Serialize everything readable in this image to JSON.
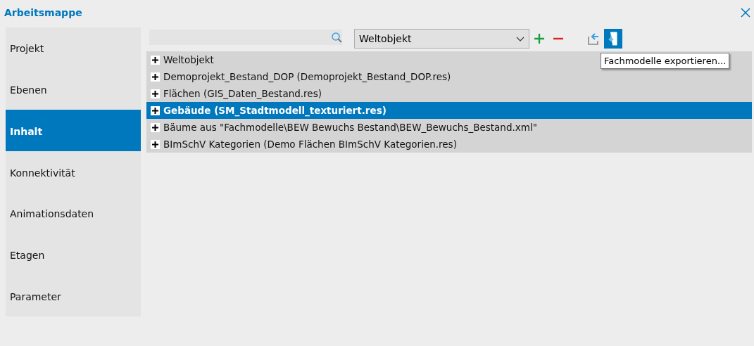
{
  "window": {
    "title": "Arbeitsmappe"
  },
  "sidebar": {
    "items": [
      {
        "label": "Projekt",
        "selected": false
      },
      {
        "label": "Ebenen",
        "selected": false
      },
      {
        "label": "Inhalt",
        "selected": true
      },
      {
        "label": "Konnektivität",
        "selected": false
      },
      {
        "label": "Animationsdaten",
        "selected": false
      },
      {
        "label": "Etagen",
        "selected": false
      },
      {
        "label": "Parameter",
        "selected": false
      }
    ]
  },
  "toolbar": {
    "dropdown": {
      "value": "Weltobjekt"
    },
    "buttons": [
      {
        "kind": "add",
        "highlighted": false
      },
      {
        "kind": "remove",
        "highlighted": false
      },
      {
        "kind": "import",
        "highlighted": false
      },
      {
        "kind": "export",
        "highlighted": true
      }
    ],
    "tooltip": "Fachmodelle exportieren..."
  },
  "tree": {
    "rows": [
      {
        "label": "Weltobjekt",
        "selected": false
      },
      {
        "label": "Demoprojekt_Bestand_DOP (Demoprojekt_Bestand_DOP.res)",
        "selected": false
      },
      {
        "label": "Flächen (GIS_Daten_Bestand.res)",
        "selected": false
      },
      {
        "label": "Gebäude (SM_Stadtmodell_texturiert.res)",
        "selected": true
      },
      {
        "label": "Bäume aus \"Fachmodelle\\BEW Bewuchs Bestand\\BEW_Bewuchs_Bestand.xml\"",
        "selected": false
      },
      {
        "label": "BImSchV Kategorien (Demo Flächen BImSchV Kategorien.res)",
        "selected": false
      }
    ]
  }
}
